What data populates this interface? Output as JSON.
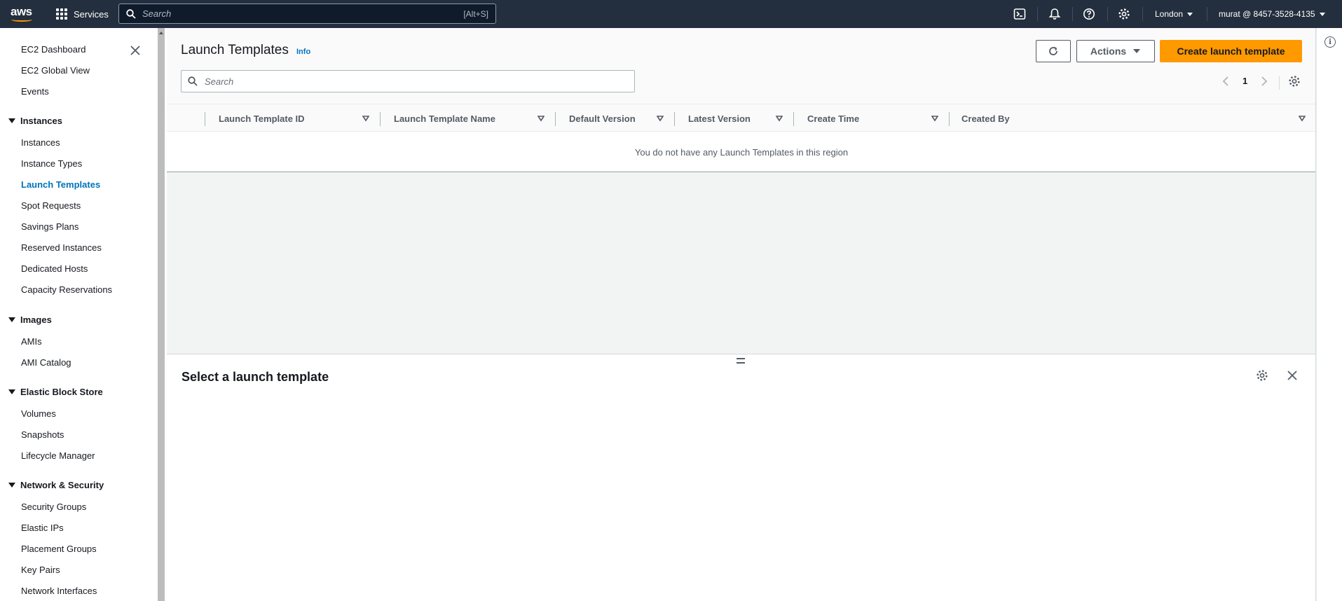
{
  "topnav": {
    "logo": "aws",
    "services_label": "Services",
    "search_placeholder": "Search",
    "search_shortcut": "[Alt+S]",
    "region": "London",
    "account": "murat @ 8457-3528-4135",
    "icons": [
      "cloudshell-icon",
      "bell-icon",
      "help-icon",
      "settings-icon"
    ]
  },
  "sidebar": {
    "top_items": [
      {
        "label": "EC2 Dashboard"
      },
      {
        "label": "EC2 Global View"
      },
      {
        "label": "Events"
      }
    ],
    "sections": [
      {
        "title": "Instances",
        "items": [
          "Instances",
          "Instance Types",
          "Launch Templates",
          "Spot Requests",
          "Savings Plans",
          "Reserved Instances",
          "Dedicated Hosts",
          "Capacity Reservations"
        ]
      },
      {
        "title": "Images",
        "items": [
          "AMIs",
          "AMI Catalog"
        ]
      },
      {
        "title": "Elastic Block Store",
        "items": [
          "Volumes",
          "Snapshots",
          "Lifecycle Manager"
        ]
      },
      {
        "title": "Network & Security",
        "items": [
          "Security Groups",
          "Elastic IPs",
          "Placement Groups",
          "Key Pairs",
          "Network Interfaces"
        ]
      }
    ],
    "active_item": "Launch Templates"
  },
  "main": {
    "title": "Launch Templates",
    "info_label": "Info",
    "actions_label": "Actions",
    "create_label": "Create launch template",
    "search_placeholder": "Search",
    "page_number": "1",
    "columns": [
      "Launch Template ID",
      "Launch Template Name",
      "Default Version",
      "Latest Version",
      "Create Time",
      "Created By"
    ],
    "empty_message": "You do not have any Launch Templates in this region",
    "detail_title": "Select a launch template"
  },
  "colors": {
    "nav_bg": "#232f3e",
    "accent": "#ff9900",
    "link": "#0073bb"
  }
}
